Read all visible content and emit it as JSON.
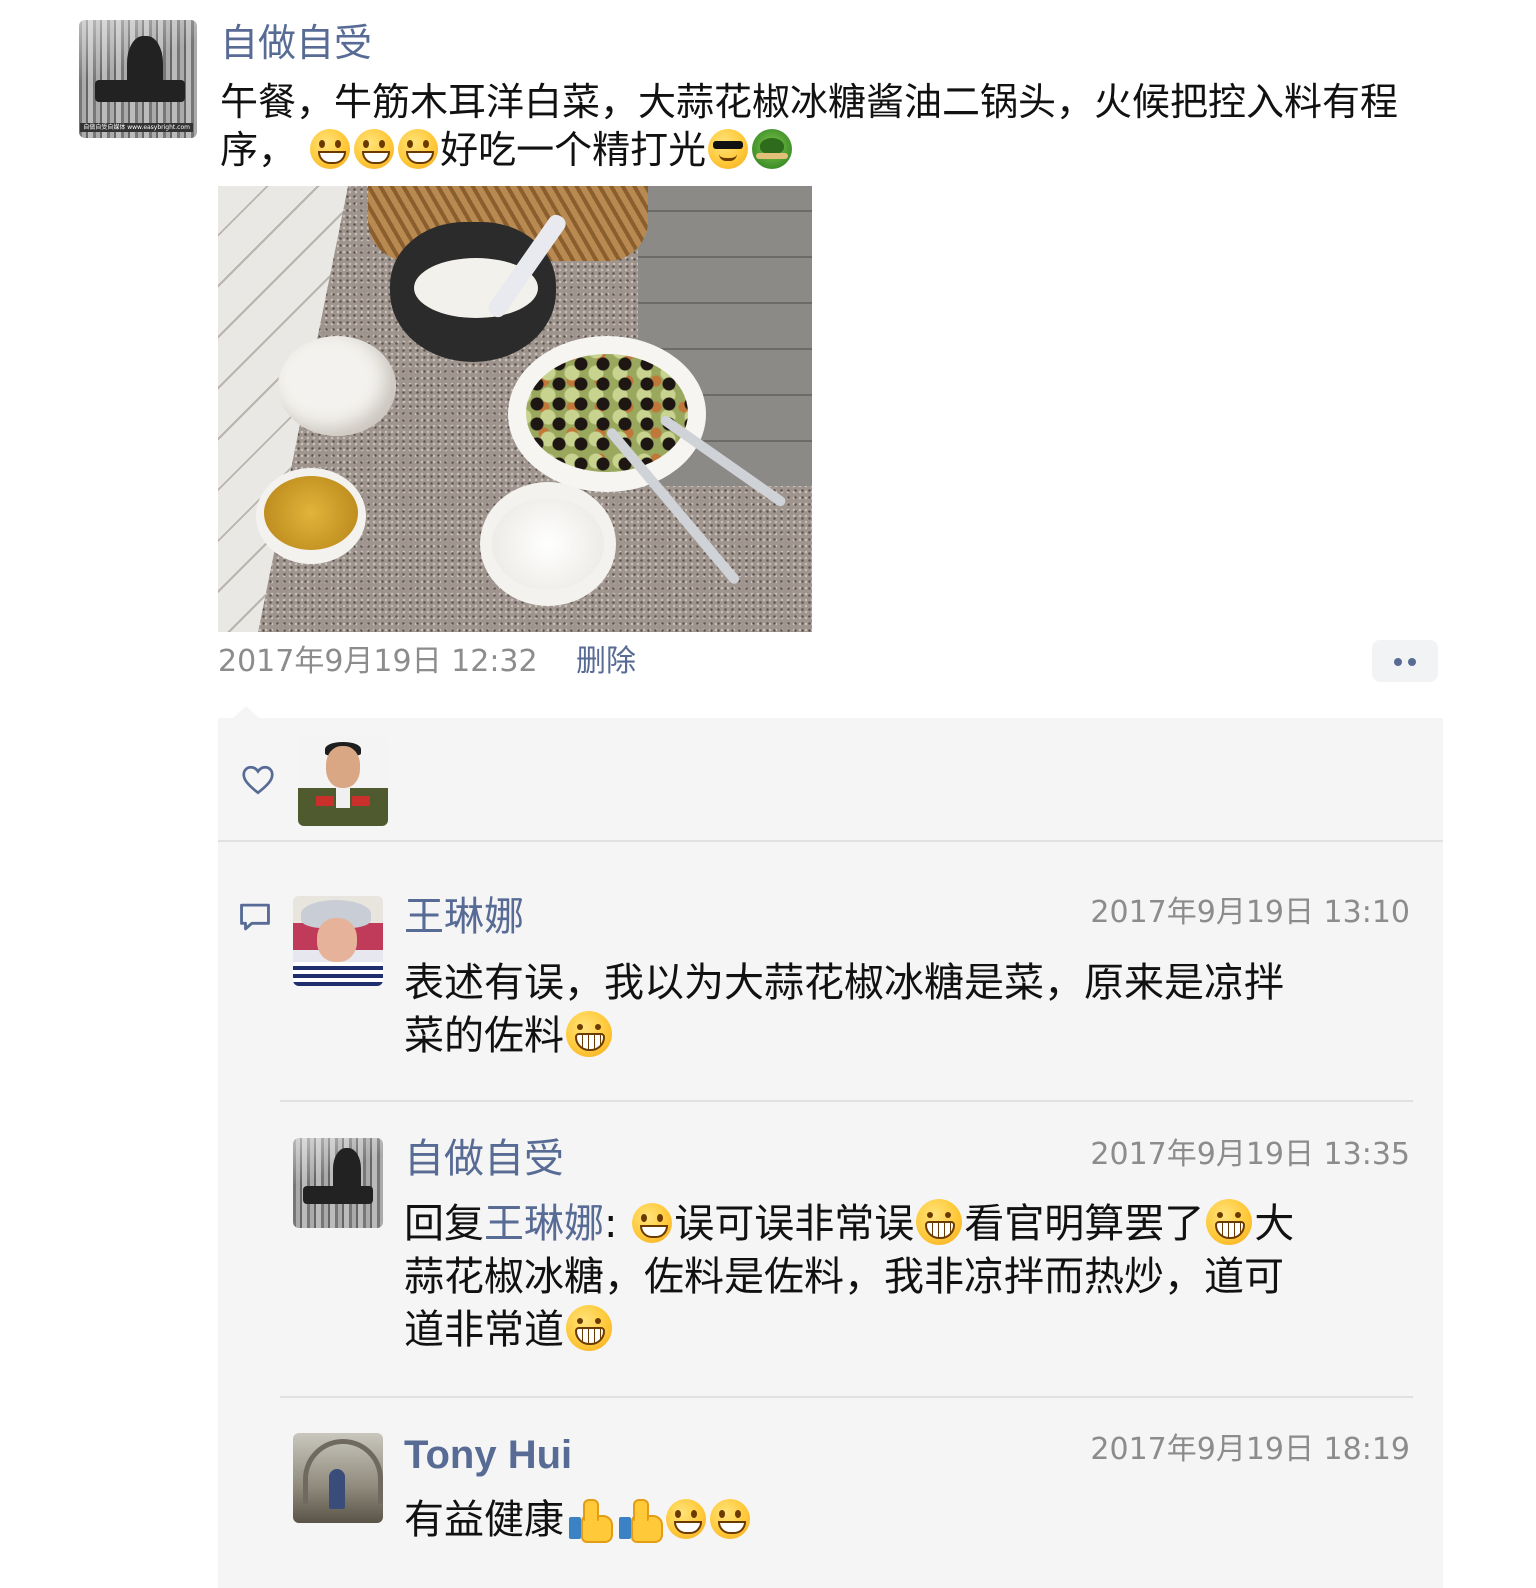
{
  "post": {
    "author": "自做自受",
    "text_main": "午餐，牛筋木耳洋白菜，大蒜花椒冰糖酱油二锅头，火候把控入料有程序，",
    "text_tail": "好吃一个精打光",
    "emoji_after_main": [
      "grin-emoji",
      "grin-emoji",
      "grin-emoji"
    ],
    "emoji_after_tail": [
      "sunglasses-emoji",
      "turtle-emoji"
    ],
    "avatar_caption": "自做自受自媒体 www.easybright.com",
    "photo_subject": "lunch table photo",
    "time": "2017年9月19日 12:32",
    "delete_label": "删除",
    "more_icon": "more-dots-icon"
  },
  "likes": {
    "icon": "heart-icon",
    "users": [
      "liker-avatar"
    ]
  },
  "comments_icon": "comment-bubble-icon",
  "comments": [
    {
      "name": "王琳娜",
      "time": "2017年9月19日 13:10",
      "line1": "表述有误，我以为大蒜花椒冰糖是菜，原来是凉拌",
      "line2": "菜的佐料"
    },
    {
      "name": "自做自受",
      "time": "2017年9月19日 13:35",
      "reply_prefix": "回复",
      "reply_to": "王琳娜",
      "colon": ":",
      "part1": "误可误非常误",
      "part2": "看官明算罢了",
      "part3": "大",
      "line2": "蒜花椒冰糖，佐料是佐料，我非凉拌而热炒，道可",
      "line3": "道非常道"
    },
    {
      "name": "Tony Hui",
      "time": "2017年9月19日 18:19",
      "text": "有益健康"
    }
  ]
}
